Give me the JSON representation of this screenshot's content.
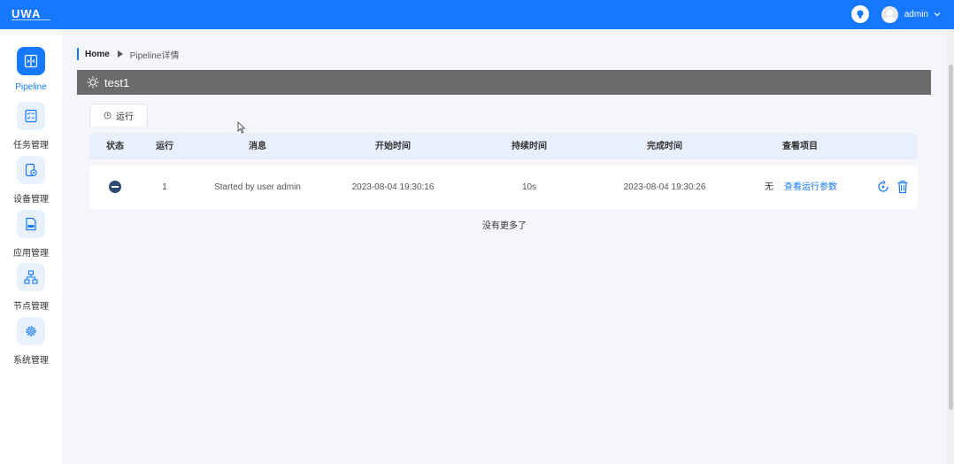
{
  "app": {
    "logo_text": "UWA"
  },
  "header": {
    "username": "admin"
  },
  "sidebar": {
    "items": [
      {
        "label": "Pipeline",
        "icon": "pipeline-icon",
        "active": true
      },
      {
        "label": "任务管理",
        "icon": "task-list-icon"
      },
      {
        "label": "设备管理",
        "icon": "device-settings-icon"
      },
      {
        "label": "应用管理",
        "icon": "apk-file-icon"
      },
      {
        "label": "节点管理",
        "icon": "node-tree-icon"
      },
      {
        "label": "系统管理",
        "icon": "gear-icon"
      }
    ]
  },
  "breadcrumb": {
    "home": "Home",
    "current": "Pipeline详情"
  },
  "pipeline": {
    "title": "test1"
  },
  "tabs": {
    "run": "运行"
  },
  "table": {
    "columns": [
      "状态",
      "运行",
      "消息",
      "开始时间",
      "持续时间",
      "完成时间",
      "查看项目"
    ],
    "rows": [
      {
        "status": "stopped",
        "run": "1",
        "message": "Started by user admin",
        "start_time": "2023-08-04 19:30:16",
        "duration": "10s",
        "end_time": "2023-08-04 19:30:26",
        "project": "无",
        "params_link": "查看运行参数"
      }
    ]
  },
  "footer": {
    "no_more": "没有更多了"
  },
  "colors": {
    "primary": "#1677ff",
    "title_bar": "#6b6b6b",
    "table_header": "#e8f0fd"
  }
}
